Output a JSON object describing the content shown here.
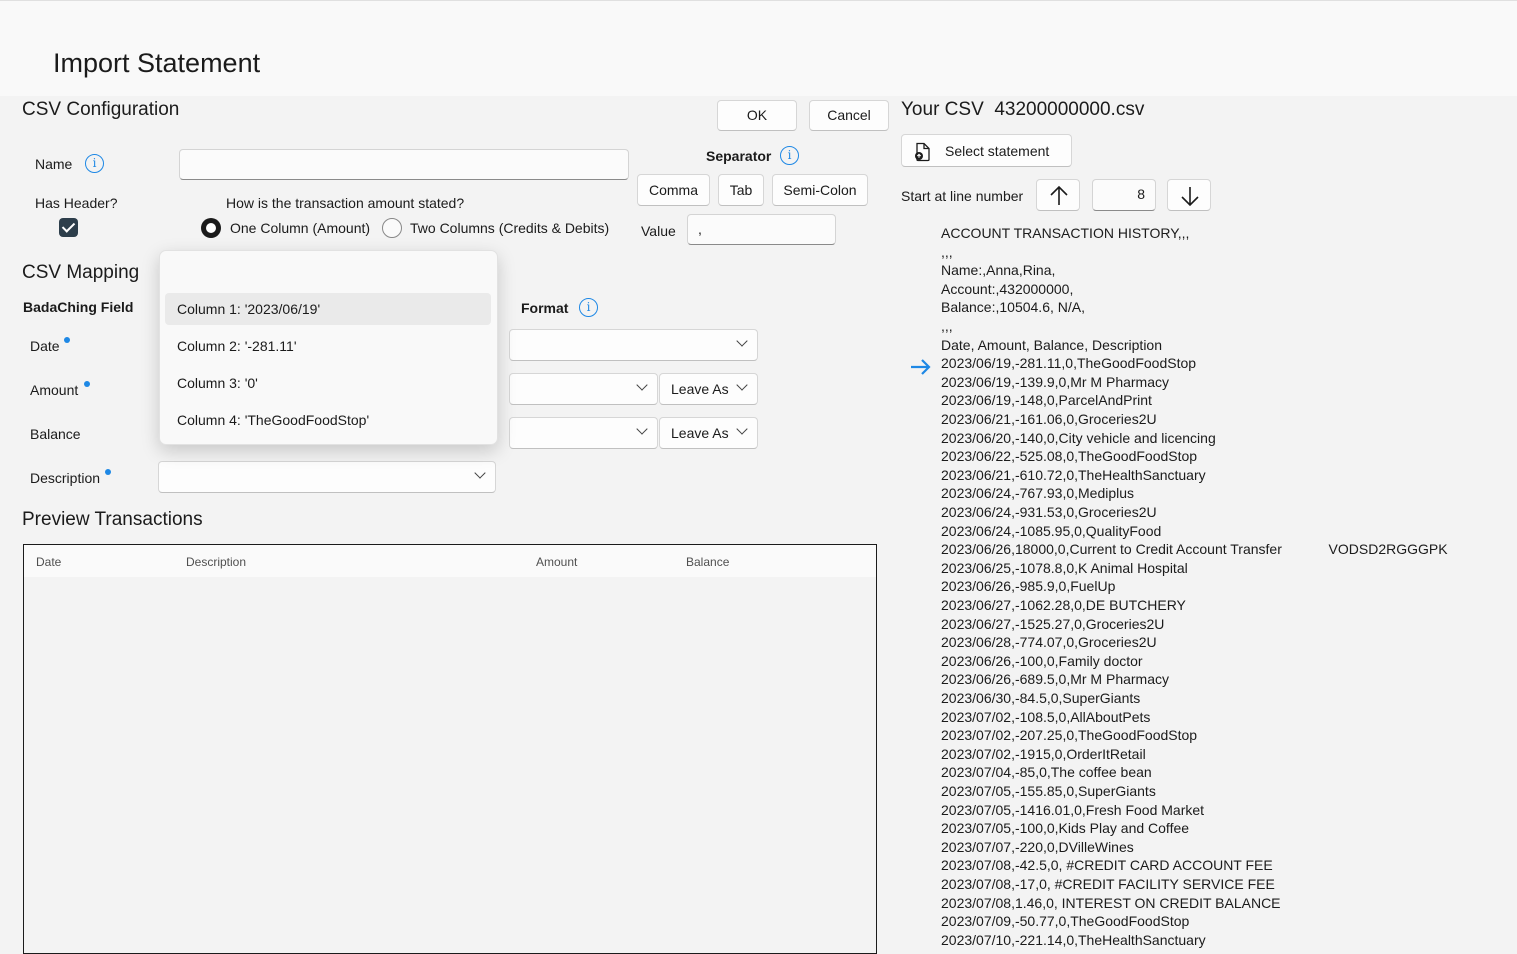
{
  "page": {
    "title": "Import Statement"
  },
  "config": {
    "heading": "CSV Configuration",
    "name_label": "Name",
    "name_value": "",
    "has_header_label": "Has Header?",
    "has_header_checked": true,
    "amount_question": "How is the transaction amount stated?",
    "radio_one": "One Column (Amount)",
    "radio_two": "Two Columns (Credits & Debits)",
    "separator_label": "Separator",
    "separator_buttons": [
      "Comma",
      "Tab",
      "Semi-Colon"
    ],
    "value_label": "Value",
    "value_text": ","
  },
  "actions": {
    "ok": "OK",
    "cancel": "Cancel"
  },
  "mapping": {
    "heading": "CSV Mapping",
    "field_header": "BadaChing Field",
    "format_header": "Format",
    "fields": [
      {
        "label": "Date",
        "required": true
      },
      {
        "label": "Amount",
        "required": true
      },
      {
        "label": "Balance",
        "required": false
      },
      {
        "label": "Description",
        "required": true
      }
    ],
    "leave_as": "Leave As",
    "dropdown_options": [
      "Column 1: '2023/06/19'",
      "Column 2: '-281.11'",
      "Column 3: '0'",
      "Column 4: 'TheGoodFoodStop'"
    ]
  },
  "preview": {
    "heading": "Preview Transactions",
    "columns": [
      "Date",
      "Description",
      "Amount",
      "Balance"
    ]
  },
  "csv": {
    "heading": "Your CSV",
    "filename": "43200000000.csv",
    "select_button": "Select statement",
    "start_label": "Start at line number",
    "start_value": "8",
    "current_line_index": 7,
    "lines": [
      "ACCOUNT TRANSACTION HISTORY,,,",
      ",,,",
      "Name:,Anna,Rina,",
      "Account:,432000000,",
      "Balance:,10504.6, N/A,",
      ",,,",
      "Date, Amount, Balance, Description",
      "2023/06/19,-281.11,0,TheGoodFoodStop",
      "2023/06/19,-139.9,0,Mr M Pharmacy",
      "2023/06/19,-148,0,ParcelAndPrint",
      "2023/06/21,-161.06,0,Groceries2U",
      "2023/06/20,-140,0,City vehicle and licencing",
      "2023/06/22,-525.08,0,TheGoodFoodStop",
      "2023/06/21,-610.72,0,TheHealthSanctuary",
      "2023/06/24,-767.93,0,Mediplus",
      "2023/06/24,-931.53,0,Groceries2U",
      "2023/06/24,-1085.95,0,QualityFood",
      "2023/06/26,18000,0,Current to Credit Account Transfer            VODSD2RGGGPK",
      "2023/06/25,-1078.8,0,K Animal Hospital",
      "2023/06/26,-985.9,0,FuelUp",
      "2023/06/27,-1062.28,0,DE BUTCHERY",
      "2023/06/27,-1525.27,0,Groceries2U",
      "2023/06/28,-774.07,0,Groceries2U",
      "2023/06/26,-100,0,Family doctor",
      "2023/06/26,-689.5,0,Mr M Pharmacy",
      "2023/06/30,-84.5,0,SuperGiants",
      "2023/07/02,-108.5,0,AllAboutPets",
      "2023/07/02,-207.25,0,TheGoodFoodStop",
      "2023/07/02,-1915,0,OrderItRetail",
      "2023/07/04,-85,0,The coffee bean",
      "2023/07/05,-155.85,0,SuperGiants",
      "2023/07/05,-1416.01,0,Fresh Food Market",
      "2023/07/05,-100,0,Kids Play and Coffee",
      "2023/07/07,-220,0,DVilleWines",
      "2023/07/08,-42.5,0, #CREDIT CARD ACCOUNT FEE",
      "2023/07/08,-17,0, #CREDIT FACILITY SERVICE FEE",
      "2023/07/08,1.46,0, INTEREST ON CREDIT BALANCE",
      "2023/07/09,-50.77,0,TheGoodFoodStop",
      "2023/07/10,-221.14,0,TheHealthSanctuary"
    ]
  },
  "colors": {
    "accent": "#1e88e5",
    "background": "#f3f3f3",
    "titlebar": "#f9f9f9"
  },
  "icons": {
    "info": "info-icon",
    "arrow_up": "arrow-up-icon",
    "arrow_down": "arrow-down-icon",
    "file": "file-icon",
    "pointer": "arrow-right-icon"
  }
}
